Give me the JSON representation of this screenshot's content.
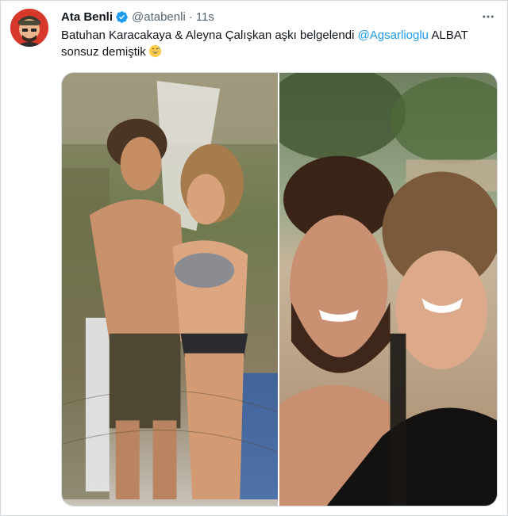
{
  "tweet": {
    "display_name": "Ata Benli",
    "handle": "@atabenli",
    "separator": "·",
    "timestamp": "11s",
    "text_part1": "Batuhan Karacakaya & Aleyna Çalışkan aşkı belgelendi ",
    "mention": "@Agsarlioglu",
    "text_part2": " ALBAT sonsuz demiştik",
    "emoji": "grinning-sweat-emoji"
  },
  "icons": {
    "verified": "verified-badge-icon",
    "more": "more-options-icon"
  },
  "colors": {
    "accent": "#1d9bf0",
    "secondary_text": "#536471",
    "avatar_bg": "#d6392c",
    "border": "#cfd9de"
  }
}
